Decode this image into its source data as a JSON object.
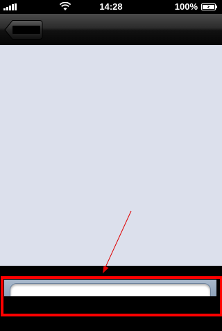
{
  "status_bar": {
    "time": "14:28",
    "battery_percent": "100%",
    "signal_icon": "signal-bars-icon",
    "wifi_icon": "wifi-icon",
    "battery_icon": "battery-charging-icon"
  },
  "nav_bar": {
    "back_button_icon": "back-arrow-button",
    "back_label": ""
  },
  "composer": {
    "input_value": "",
    "input_placeholder": ""
  },
  "annotation": {
    "highlight_color": "#ff0000"
  }
}
